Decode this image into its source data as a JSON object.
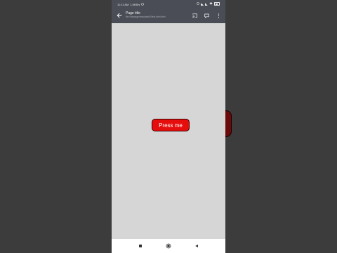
{
  "status_bar": {
    "time": "11:11 AM",
    "net_speed": "1.6KB/s",
    "battery_level": "62"
  },
  "app_bar": {
    "title": "Page title",
    "url": "file:///storage/emulated/0/test.html.html"
  },
  "main": {
    "button_label": "Press me",
    "button_color": "#e60d0d",
    "background_color": "#d6d6d6"
  },
  "nav_bar": {
    "recents_icon": "square-icon",
    "home_icon": "circle-icon",
    "back_icon": "triangle-back-icon"
  }
}
